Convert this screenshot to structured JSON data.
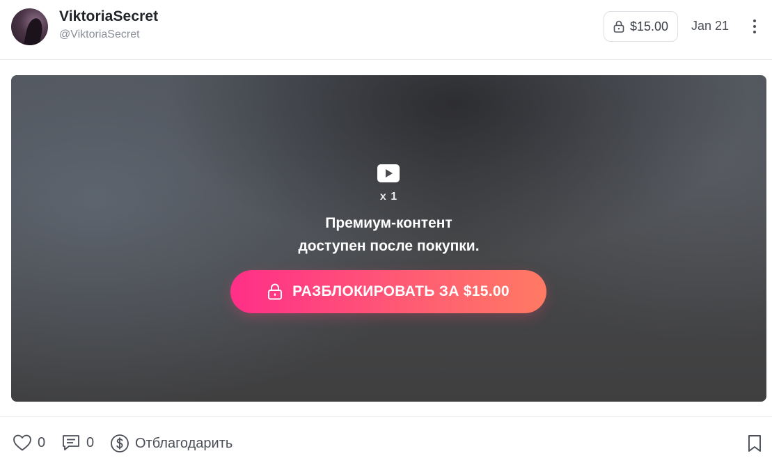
{
  "header": {
    "display_name": "ViktoriaSecret",
    "username": "@ViktoriaSecret",
    "price": "$15.00",
    "date": "Jan 21",
    "icons": {
      "avatar": "avatar-image",
      "price_icon": "lock-icon",
      "menu": "more-vertical-icon"
    }
  },
  "media": {
    "count": "x 1",
    "message_line1": "Премиум-контент",
    "message_line2": "доступен после покупки.",
    "unlock_label": "РАЗБЛОКИРОВАТЬ ЗА $15.00",
    "icons": {
      "media_type": "video-play-icon",
      "unlock": "lock-icon"
    }
  },
  "footer": {
    "likes": "0",
    "comments": "0",
    "tip_label": "Отблагодарить",
    "icons": {
      "like": "heart-icon",
      "comment": "comment-icon",
      "tip": "dollar-icon",
      "bookmark": "bookmark-icon"
    }
  },
  "colors": {
    "accent_gradient_start": "#ff2f88",
    "accent_gradient_end": "#ff7a63",
    "text_primary": "#1f2328",
    "text_secondary": "#8a8f98"
  }
}
